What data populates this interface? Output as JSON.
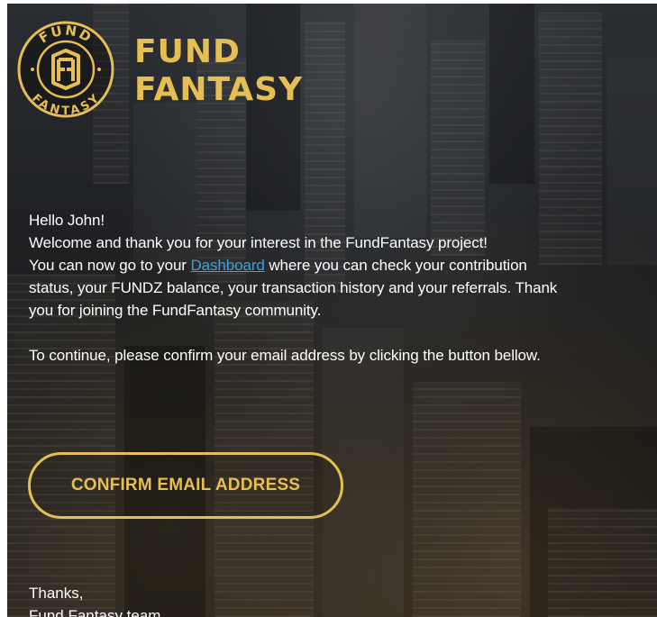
{
  "brand": {
    "logo_ring_top": "FUND",
    "logo_ring_bottom": "FANTASY",
    "name_line1": "FUND",
    "name_line2": "FANTASY",
    "accent_color": "#e5bf53"
  },
  "message": {
    "greeting": "Hello John!",
    "welcome": "Welcome and thank you for your interest in the FundFantasy project!",
    "dashboard_prefix": "You can now go to your ",
    "dashboard_link": "Dashboard",
    "dashboard_suffix": " where you can check your contribution",
    "line4": "status, your FUNDZ balance, your transaction history and your referrals. Thank",
    "line5": "you for joining the FundFantasy community.",
    "confirm_instruction": "To continue, please confirm your email address by clicking the button bellow.",
    "link_color": "#3aa0e0"
  },
  "button": {
    "confirm_label": "CONFIRM EMAIL ADDRESS"
  },
  "signoff": {
    "thanks": "Thanks,",
    "team": "Fund Fantasy team"
  },
  "icons": {
    "logo": "fund-fantasy-logo-icon"
  }
}
